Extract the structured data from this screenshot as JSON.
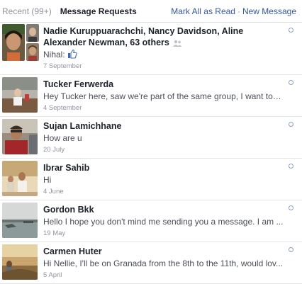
{
  "header": {
    "recent_label": "Recent (99+)",
    "requests_label": "Message Requests",
    "mark_all_label": "Mark All as Read",
    "separator": "·",
    "new_message_label": "New Message"
  },
  "threads": [
    {
      "name": "Nadie Kuruppuarachchi, Nancy Davidson, Aline Alexander Newman, 63 others",
      "snippet": "Nihal:",
      "time": "7 September",
      "icons": [
        "group-icon",
        "like-icon"
      ]
    },
    {
      "name": "Tucker Ferwerda",
      "snippet": "Hey Tucker here, saw we're part of the same group, I want to t...",
      "time": "4 September"
    },
    {
      "name": "Sujan Lamichhane",
      "snippet": "How are u",
      "time": "20 July"
    },
    {
      "name": "Ibrar Sahib",
      "snippet": "Hi",
      "time": "4 June"
    },
    {
      "name": "Gordon Bkk",
      "snippet": "Hello I hope you don't mind me sending you a message. I am ...",
      "time": "19 May"
    },
    {
      "name": "Carmen Huter",
      "snippet": "Hi Nellie, I'll be on Granada from the 8th to the 11th, would lov...",
      "time": "5 April"
    }
  ],
  "colors": {
    "link": "#365899",
    "muted": "#90949c",
    "text": "#1d2129"
  }
}
